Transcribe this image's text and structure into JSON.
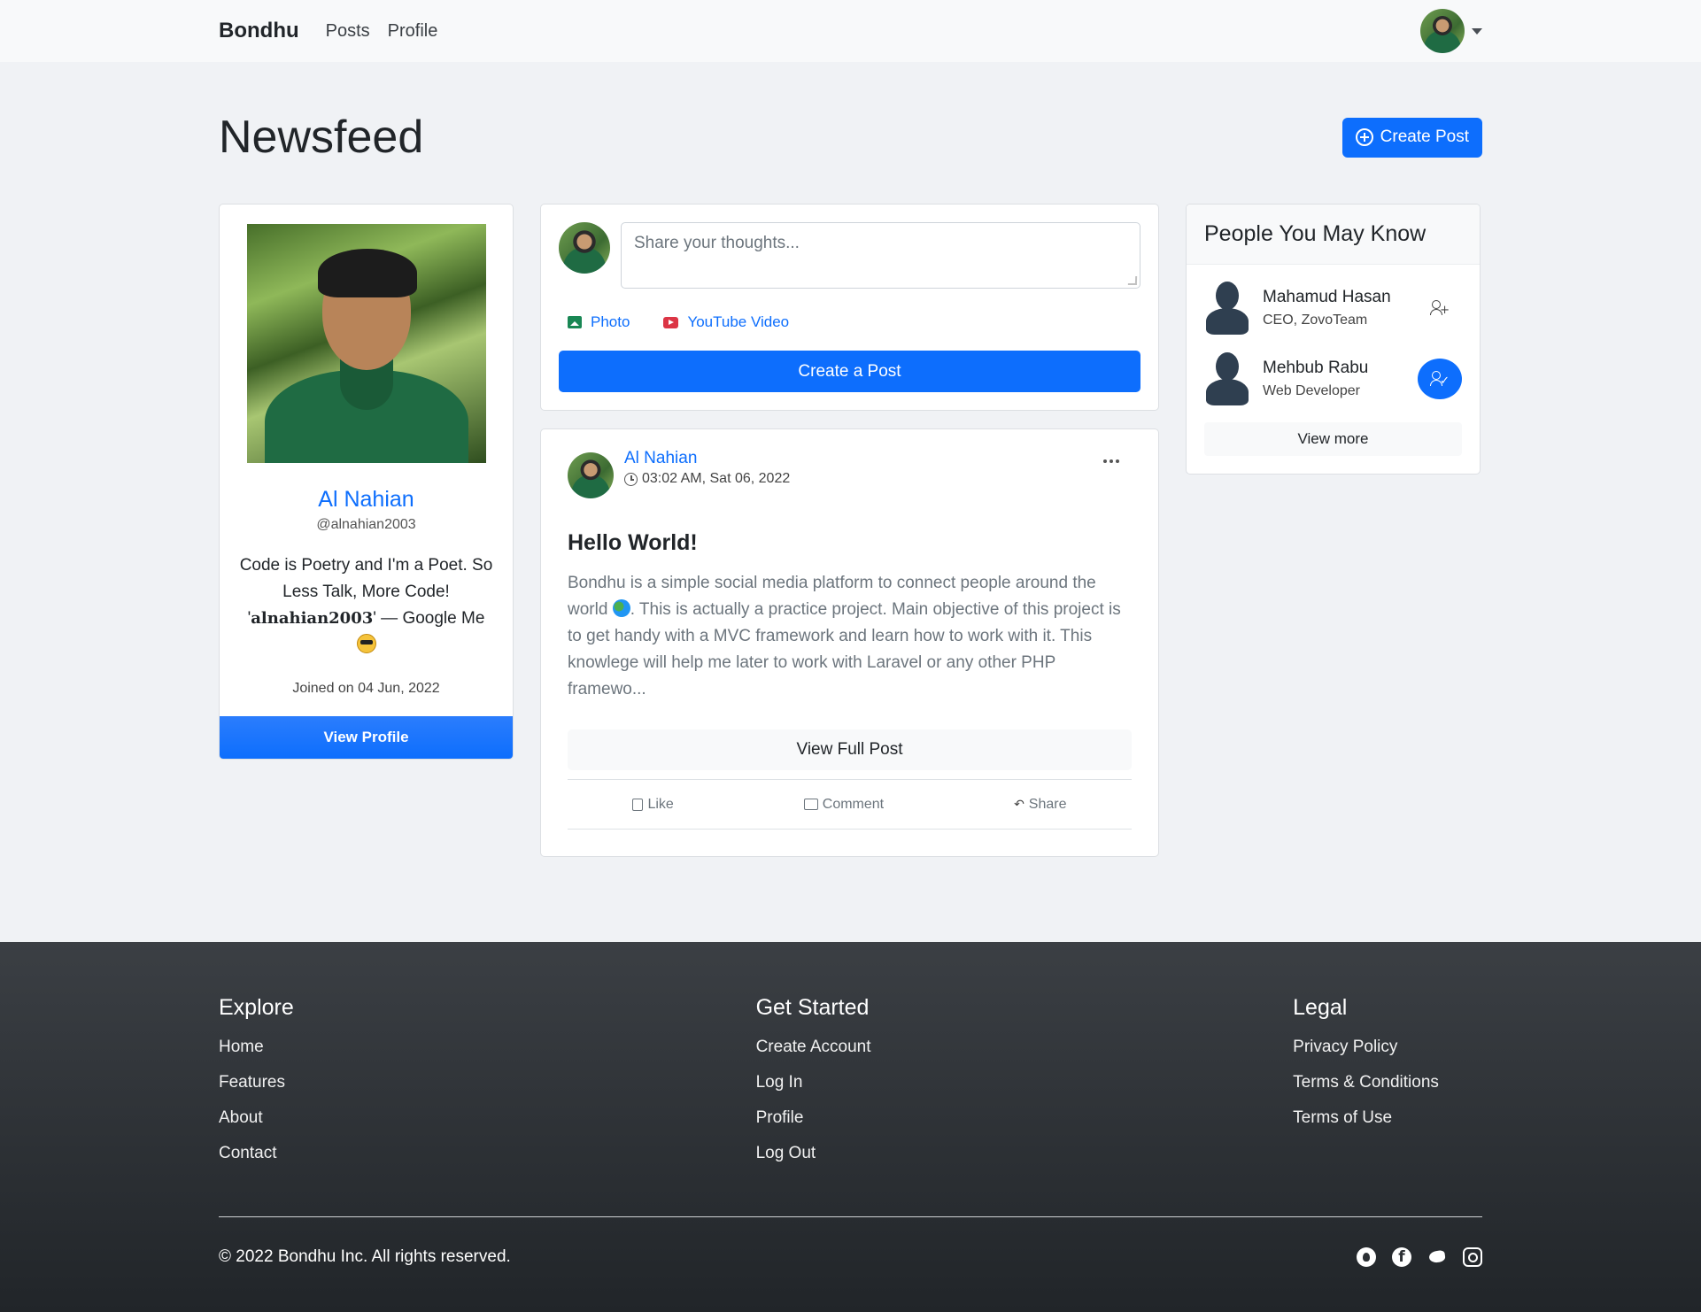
{
  "navbar": {
    "brand": "Bondhu",
    "links": [
      "Posts",
      "Profile"
    ]
  },
  "main": {
    "title": "Newsfeed",
    "create_post_button": "Create Post"
  },
  "profile": {
    "name": "Al Nahian",
    "handle": "@alnahian2003",
    "bio_prefix": "Code is Poetry and I'm a Poet. So Less Talk, More Code! '",
    "bio_bold": "alnahian2003",
    "bio_suffix": "' — Google Me",
    "joined_label": "Joined on",
    "joined_date": "04 Jun, 2022",
    "view_profile_button": "View Profile"
  },
  "composer": {
    "placeholder": "Share your thoughts...",
    "photo_label": "Photo",
    "youtube_label": "YouTube Video",
    "submit_label": "Create a Post"
  },
  "post": {
    "author": "Al Nahian",
    "timestamp": "03:02 AM, Sat 06, 2022",
    "title": "Hello World!",
    "body_part1": "Bondhu is a simple social media platform to connect people around the world ",
    "body_part2": ". This is actually a practice project. Main objective of this project is to get handy with a MVC framework and learn how to work with it. This knowlege will help me later to work with Laravel or any other PHP framewo...",
    "view_full_label": "View Full Post",
    "actions": {
      "like": "Like",
      "comment": "Comment",
      "share": "Share"
    }
  },
  "people": {
    "heading": "People You May Know",
    "items": [
      {
        "name": "Mahamud Hasan",
        "role": "CEO, ZovoTeam"
      },
      {
        "name": "Mehbub Rabu",
        "role": "Web Developer"
      }
    ],
    "view_more": "View more"
  },
  "footer": {
    "columns": [
      {
        "heading": "Explore",
        "links": [
          "Home",
          "Features",
          "About",
          "Contact"
        ]
      },
      {
        "heading": "Get Started",
        "links": [
          "Create Account",
          "Log In",
          "Profile",
          "Log Out"
        ]
      },
      {
        "heading": "Legal",
        "links": [
          "Privacy Policy",
          "Terms & Conditions",
          "Terms of Use"
        ]
      }
    ],
    "copyright": "© 2022 Bondhu Inc. All rights reserved.",
    "social_icons": [
      "github-icon",
      "facebook-icon",
      "twitter-icon",
      "instagram-icon"
    ]
  },
  "colors": {
    "primary": "#0d6efd",
    "page_bg": "#f0f2f5",
    "footer_bg": "#2c3034"
  }
}
